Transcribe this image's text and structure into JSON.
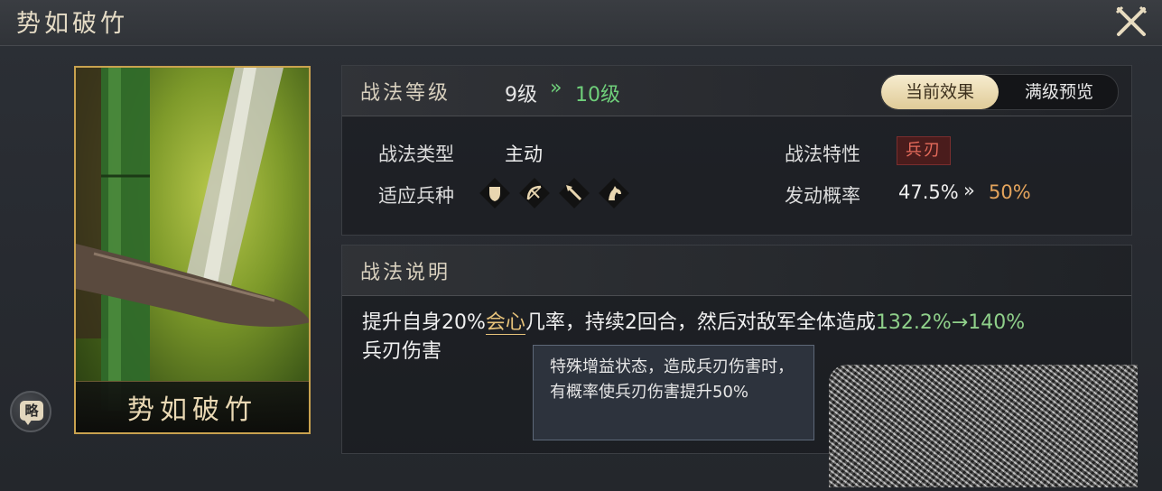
{
  "window": {
    "title": "势如破竹",
    "close_icon": "close-x-icon"
  },
  "card": {
    "name": "势如破竹",
    "strategy_button_label": "略"
  },
  "tactic": {
    "level_label": "战法等级",
    "level_current": "9级",
    "level_arrow": "»",
    "level_next": "10级",
    "toggle": {
      "active": "当前效果",
      "inactive": "满级预览"
    },
    "type_label": "战法类型",
    "type_value": "主动",
    "trait_label": "战法特性",
    "trait_value": "兵刃",
    "units_label": "适应兵种",
    "units": [
      "shield-icon",
      "bow-icon",
      "spear-icon",
      "horse-icon"
    ],
    "rate_label": "发动概率",
    "rate_current": "47.5%",
    "rate_arrow": "»",
    "rate_next": "50%"
  },
  "description": {
    "header": "战法说明",
    "part1": "提升自身20%",
    "keyword": "会心",
    "part2": "几率，持续2回合，然后对敌军全体造成",
    "damage": "132.2%→140%",
    "part3": "兵刃伤害"
  },
  "tooltip": {
    "text": "特殊增益状态，造成兵刃伤害时，有概率使兵刃伤害提升50%"
  },
  "colors": {
    "gold": "#c9a24f",
    "green": "#6fcf7a",
    "orange": "#e4a45c",
    "red_badge": "#e56b5b"
  }
}
